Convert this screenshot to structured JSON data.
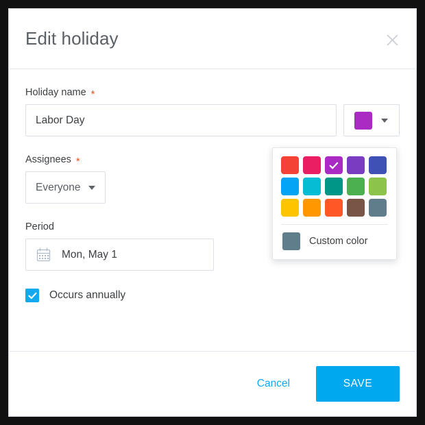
{
  "dialog": {
    "title": "Edit holiday",
    "close_icon": "close-icon"
  },
  "form": {
    "name_field": {
      "label": "Holiday name",
      "required_mark": "*",
      "value": "Labor Day",
      "placeholder": "Holiday name"
    },
    "assignees_field": {
      "label": "Assignees",
      "required_mark": "*",
      "value": "Everyone"
    },
    "period_field": {
      "label": "Period",
      "value": "Mon, May 1",
      "icon": "calendar-icon"
    },
    "annual_checkbox": {
      "label": "Occurs annually",
      "checked": true
    }
  },
  "color_picker": {
    "selected_color": "#a92bc4",
    "trigger_icon": "chevron-down-icon",
    "swatches": [
      {
        "name": "red",
        "hex": "#f44336",
        "selected": false
      },
      {
        "name": "pink",
        "hex": "#e91e63",
        "selected": false
      },
      {
        "name": "purple",
        "hex": "#a92bc4",
        "selected": true
      },
      {
        "name": "deep-purple",
        "hex": "#7a3cc0",
        "selected": false
      },
      {
        "name": "indigo",
        "hex": "#3f51b5",
        "selected": false
      },
      {
        "name": "light-blue",
        "hex": "#03a4f4",
        "selected": false
      },
      {
        "name": "cyan",
        "hex": "#05bcd4",
        "selected": false
      },
      {
        "name": "teal",
        "hex": "#009687",
        "selected": false
      },
      {
        "name": "green",
        "hex": "#4caf50",
        "selected": false
      },
      {
        "name": "light-green",
        "hex": "#8cc34a",
        "selected": false
      },
      {
        "name": "amber",
        "hex": "#ffc400",
        "selected": false
      },
      {
        "name": "orange",
        "hex": "#ff9800",
        "selected": false
      },
      {
        "name": "deep-orange",
        "hex": "#ff5726",
        "selected": false
      },
      {
        "name": "brown",
        "hex": "#795548",
        "selected": false
      },
      {
        "name": "blue-grey",
        "hex": "#607d8b",
        "selected": false
      }
    ],
    "custom": {
      "label": "Custom color",
      "hex": "#607d8b"
    }
  },
  "footer": {
    "cancel_label": "Cancel",
    "save_label": "SAVE"
  },
  "theme": {
    "accent": "#00a8f0",
    "required": "#f4511e",
    "border": "#dbe0e6"
  }
}
